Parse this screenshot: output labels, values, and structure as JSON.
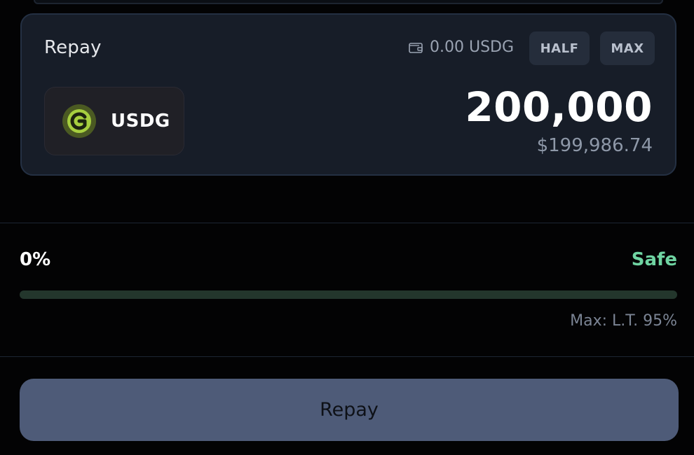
{
  "repay_card": {
    "title": "Repay",
    "wallet_balance": "0.00 USDG",
    "half_label": "HALF",
    "max_label": "MAX",
    "token_symbol": "USDG",
    "token_icon": "usdg-logo-icon",
    "amount": "200,000",
    "usd_value": "$199,986.74"
  },
  "health": {
    "value_label": "0%",
    "status_label": "Safe",
    "progress_fraction": 0,
    "max_note": "Max: L.T. 95%"
  },
  "action": {
    "repay_label": "Repay"
  },
  "colors": {
    "safe_green": "#6fd4a2",
    "button_bg": "#4e5b78",
    "card_bg": "#171d28",
    "token_logo_green": "#a6cf3f"
  }
}
